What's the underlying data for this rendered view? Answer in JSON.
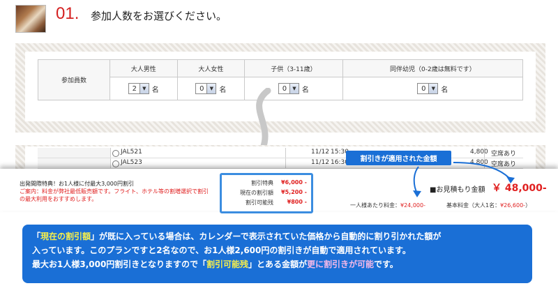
{
  "step": {
    "number": "01.",
    "title": "参加人数をお選びください。"
  },
  "party": {
    "row_label": "参加員数",
    "headers": [
      "大人男性",
      "大人女性",
      "子供（3-11歳）",
      "同伴幼児（0-2歳は無料です）"
    ],
    "selects": [
      {
        "value": "2",
        "unit": "名"
      },
      {
        "value": "0",
        "unit": "名"
      },
      {
        "value": "0",
        "unit": "名"
      },
      {
        "value": "0",
        "unit": "名"
      }
    ]
  },
  "flights": [
    {
      "name": "JAL521",
      "date": "11/12",
      "time": "15:30",
      "price": "4,800",
      "availability": "空席あり"
    },
    {
      "name": "JAL523",
      "date": "11/12",
      "time": "16:30",
      "price": "4,800",
      "availability": "空席あり"
    }
  ],
  "promo": {
    "title": "出発間際特典！お1人様に付最大3,000円割引",
    "note": "ご案内：料金が弊社最低販売額です。フライト、ホテル等の割増選択で割引の最大利用をおすすめします。"
  },
  "discount": {
    "rows": [
      {
        "label": "割引特典",
        "value": "¥6,000 -"
      },
      {
        "label": "現在の割引額",
        "value": "¥5,200 -"
      },
      {
        "label": "割引可能残",
        "value": "¥800 -"
      }
    ]
  },
  "callout": "割引きが適用された金額",
  "estimate": {
    "label": "■お見積もり金額",
    "value": "￥ 48,000-",
    "per_person_label": "一人様あたり料金：",
    "per_person_value": "¥24,000-",
    "base_label": "基本料金（大人1名：",
    "base_value": "¥26,600-",
    "base_close": "）"
  },
  "explanation": {
    "l1_a": "「",
    "l1_hl": "現在の割引額",
    "l1_b": "」が既に入っている場合は、カレンダーで表示されていた価格から自動的に割り引かれた額が",
    "l2": "入っています。このプランですと2名なので、お1人様2,600円の割引きが自動で適用されています。",
    "l3_a": "最大お1人様3,000円割引きとなりますので「",
    "l3_hl1": "割引可能残",
    "l3_b": "」とある金額が",
    "l3_hl2": "更に割引きが可能",
    "l3_c": "です。"
  },
  "colors": {
    "accent_blue": "#1a6fd6",
    "price_red": "#e02020",
    "highlight_yellow": "#f7ef4b",
    "highlight_pink": "#f3b8e8"
  }
}
